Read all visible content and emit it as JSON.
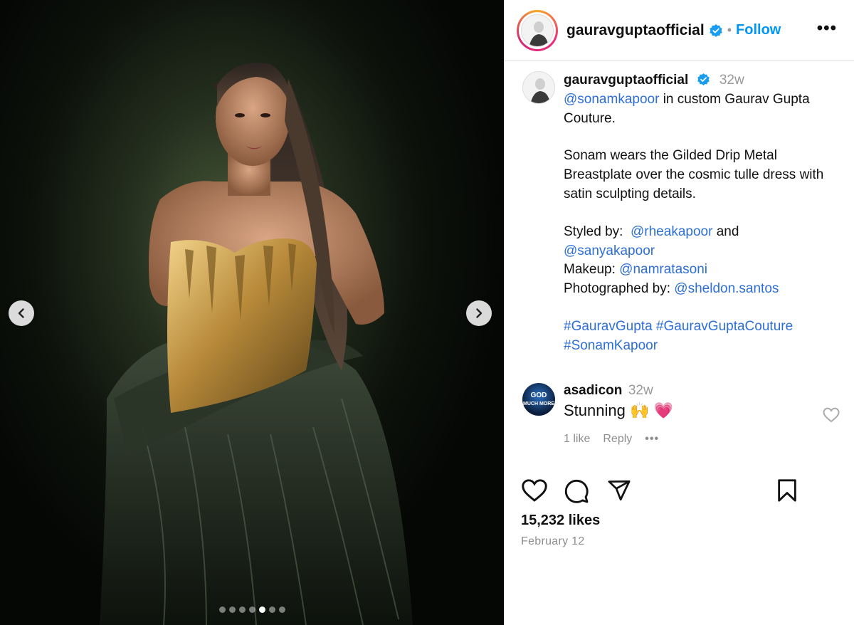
{
  "header": {
    "username": "gauravguptaofficial",
    "separator": "•",
    "follow_label": "Follow",
    "more_icon": "more-horizontal-icon",
    "more_label": "•••"
  },
  "caption": {
    "username": "gauravguptaofficial",
    "time": "32w",
    "mention_main": "@sonamkapoor",
    "line1_rest": " in custom Gaurav Gupta Couture.",
    "paragraph2": "Sonam wears the Gilded Drip Metal Breastplate over the cosmic tulle dress with satin sculpting details.",
    "styled_by_label": "Styled by:  ",
    "styled_by_1": "@rheakapoor",
    "styled_by_and": " and ",
    "styled_by_2": "@sanyakapoor",
    "makeup_label": "Makeup: ",
    "makeup": "@namratasoni",
    "photo_label": "Photographed by: ",
    "photo": "@sheldon.santos",
    "hashtag1": "#GauravGupta",
    "hashtag2": "#GauravGuptaCouture",
    "hashtag3": "#SonamKapoor"
  },
  "comment": {
    "username": "asadicon",
    "time": "32w",
    "text": "Stunning 🙌 💗",
    "likes": "1 like",
    "reply": "Reply",
    "more": "•••",
    "avatar_text": [
      "GOD",
      "MUCH MORE"
    ]
  },
  "footer": {
    "likes": "15,232 likes",
    "date": "February 12"
  },
  "carousel": {
    "total": 7,
    "active_index": 4
  },
  "colors": {
    "link": "#2d6fd6",
    "follow": "#0095f6",
    "verified": "#1a9cf0",
    "muted": "#8e8e8e"
  }
}
